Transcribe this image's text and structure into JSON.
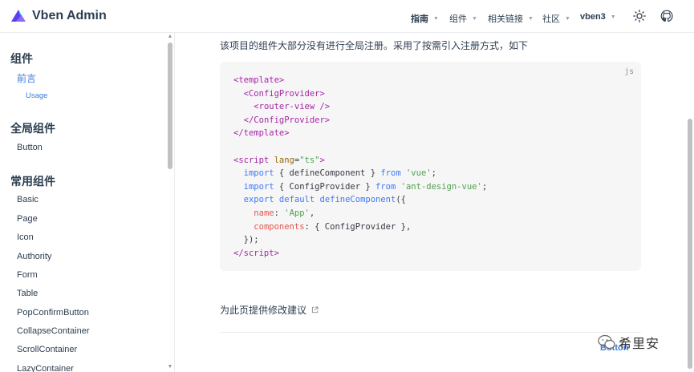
{
  "header": {
    "brand": "Vben Admin",
    "nav": [
      {
        "label": "指南"
      },
      {
        "label": "组件"
      },
      {
        "label": "相关链接"
      },
      {
        "label": "社区"
      },
      {
        "label": "vben3"
      }
    ],
    "icons": [
      "logo-icon",
      "theme-toggle-icon",
      "github-icon"
    ]
  },
  "sidebar": {
    "group1": "组件",
    "active_item": "前言",
    "sub_item": "Usage",
    "group2": "全局组件",
    "group2_items": [
      "Button"
    ],
    "group3": "常用组件",
    "group3_items": [
      "Basic",
      "Page",
      "Icon",
      "Authority",
      "Form",
      "Table",
      "PopConfirmButton",
      "CollapseContainer",
      "ScrollContainer",
      "LazyContainer"
    ]
  },
  "main": {
    "intro": "该项目的组件大部分没有进行全局注册。采用了按需引入注册方式，如下",
    "code_lang": "js",
    "edit_link": "为此页提供修改建议",
    "partial_link": "Button"
  },
  "watermark": {
    "text": "希里安"
  },
  "colors": {
    "accent": "#3f7bd8",
    "text": "#2c3e50",
    "code_bg": "#f6f6f7"
  }
}
